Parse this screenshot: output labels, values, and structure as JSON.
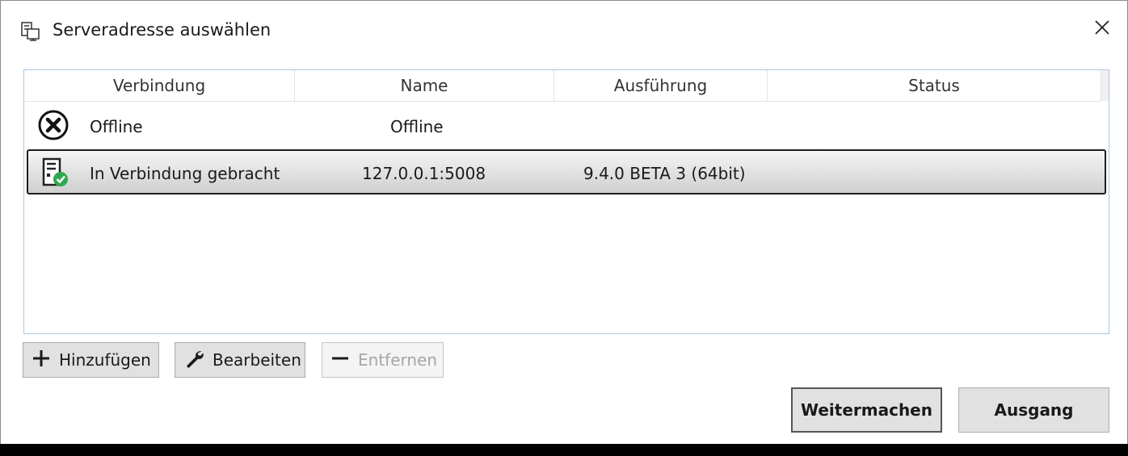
{
  "dialog": {
    "title": "Serveradresse auswählen",
    "title_icon": "server-connection-icon",
    "close_icon": "close-icon"
  },
  "list": {
    "columns": [
      "Verbindung",
      "Name",
      "Ausführung",
      "Status"
    ],
    "rows": [
      {
        "icon": "offline-x-icon",
        "verbindung": "Offline",
        "name": "Offline",
        "ausfuehrung": "",
        "status": "",
        "selected": false
      },
      {
        "icon": "server-connected-icon",
        "verbindung": "In Verbindung gebracht",
        "name": "127.0.0.1:5008",
        "ausfuehrung": "9.4.0 BETA 3 (64bit)",
        "status": "",
        "selected": true
      }
    ]
  },
  "toolbar": {
    "add_label": "Hinzufügen",
    "add_icon": "plus-icon",
    "edit_label": "Bearbeiten",
    "edit_icon": "wrench-icon",
    "remove_label": "Entfernen",
    "remove_icon": "minus-icon",
    "remove_disabled": true
  },
  "actions": {
    "continue_label": "Weitermachen",
    "exit_label": "Ausgang"
  },
  "colors": {
    "list_border": "#a9c7e3",
    "connected_green": "#2fa84f",
    "button_face": "#e1e1e1"
  }
}
